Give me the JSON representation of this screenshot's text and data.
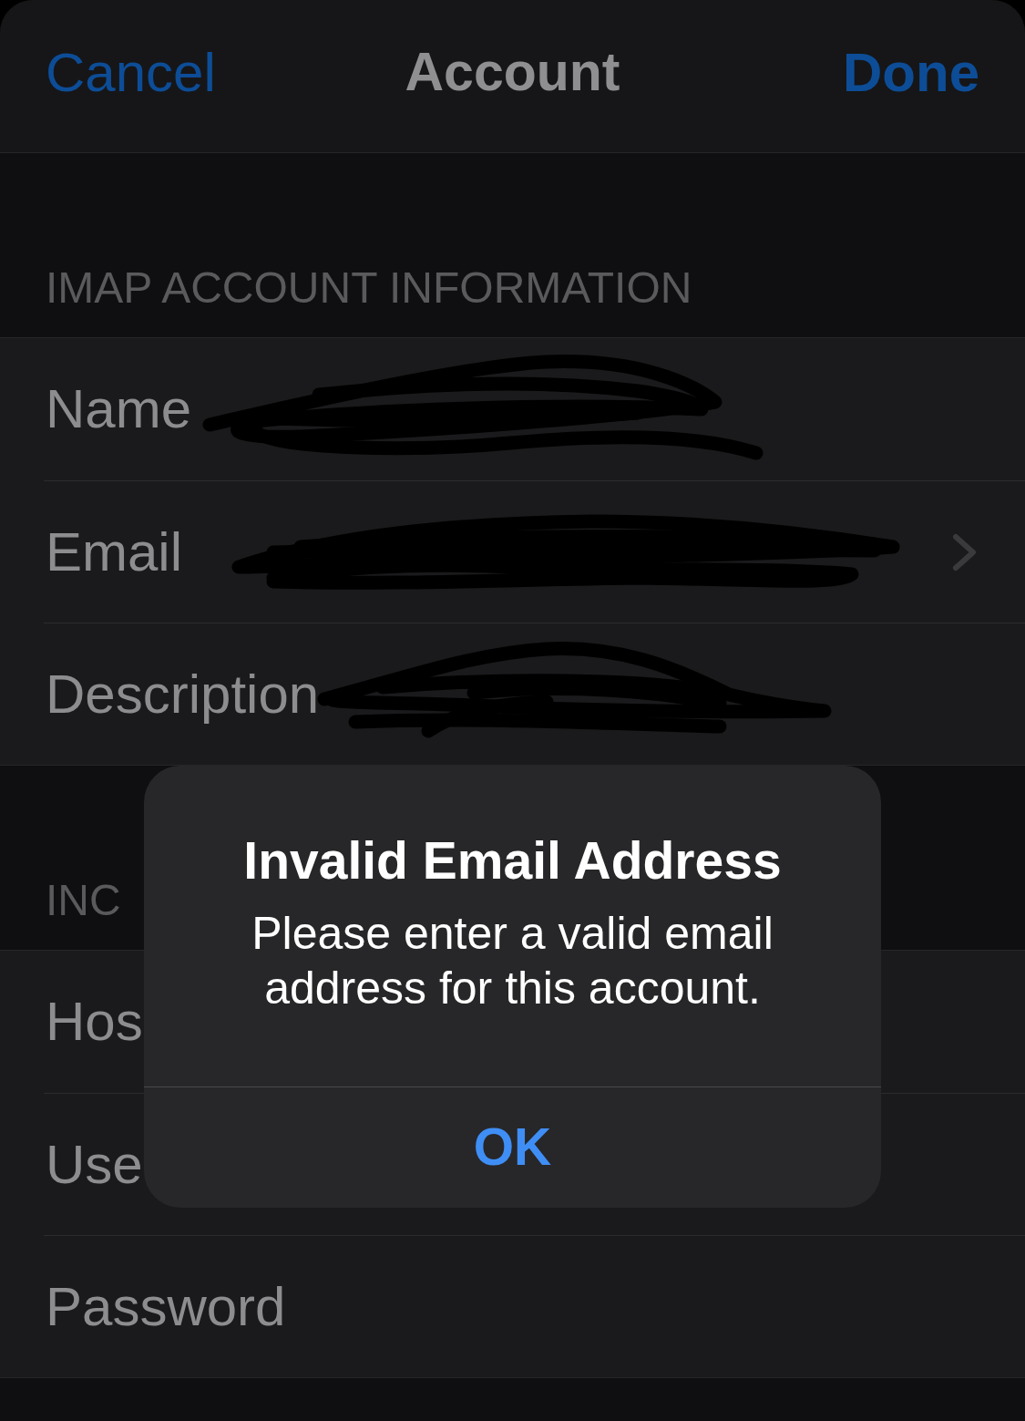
{
  "nav_bar": {
    "cancel": "Cancel",
    "title": "Account",
    "done": "Done"
  },
  "sections": [
    {
      "header": "IMAP ACCOUNT INFORMATION",
      "rows": [
        {
          "label": "Name",
          "redacted": true,
          "chevron": false
        },
        {
          "label": "Email",
          "redacted": true,
          "chevron": true
        },
        {
          "label": "Description",
          "redacted": true,
          "chevron": false
        }
      ]
    },
    {
      "header": "INC",
      "rows": [
        {
          "label": "Hos",
          "redacted": false,
          "chevron": false
        },
        {
          "label": "Use",
          "redacted": false,
          "chevron": false
        },
        {
          "label": "Password",
          "redacted": false,
          "chevron": false
        }
      ]
    }
  ],
  "alert": {
    "title": "Invalid Email Address",
    "message": "Please enter a valid email address for this account.",
    "buttons": [
      "OK"
    ]
  }
}
